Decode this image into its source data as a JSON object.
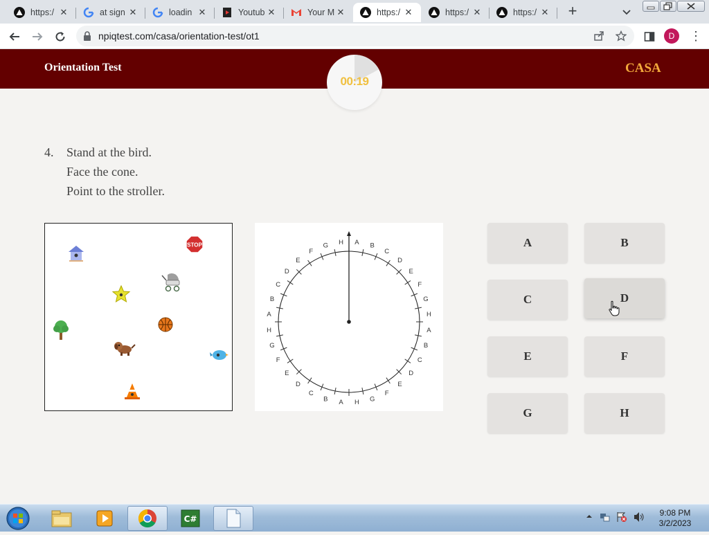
{
  "browser": {
    "tabs": [
      {
        "title": "https:/",
        "favicon": "triangle-site-icon",
        "active": false
      },
      {
        "title": "at sign",
        "favicon": "google-icon",
        "active": false
      },
      {
        "title": "loadin",
        "favicon": "google-icon",
        "active": false
      },
      {
        "title": "Youtub",
        "favicon": "youtube-studio-icon",
        "active": false
      },
      {
        "title": "Your M",
        "favicon": "gmail-icon",
        "active": false
      },
      {
        "title": "https:/",
        "favicon": "triangle-site-icon",
        "active": true
      },
      {
        "title": "https:/",
        "favicon": "triangle-site-icon",
        "active": false
      },
      {
        "title": "https:/",
        "favicon": "triangle-site-icon",
        "active": false
      }
    ],
    "url": "npiqtest.com/casa/orientation-test/ot1",
    "profile_initial": "D",
    "profile_color": "#c2185b"
  },
  "app": {
    "title": "Orientation Test",
    "brand": "CASA",
    "header_color": "#630000",
    "brand_color": "#f3a93b",
    "timer": {
      "text": "00:19",
      "elapsed_fraction": 0.12
    }
  },
  "question": {
    "number": "4.",
    "lines": [
      "Stand at the bird.",
      "Face the cone.",
      "Point to the stroller."
    ]
  },
  "map": {
    "items": [
      {
        "name": "birdhouse"
      },
      {
        "name": "stop-sign",
        "label": "STOP"
      },
      {
        "name": "stroller"
      },
      {
        "name": "star"
      },
      {
        "name": "tree"
      },
      {
        "name": "basketball"
      },
      {
        "name": "dog"
      },
      {
        "name": "bird"
      },
      {
        "name": "cone"
      }
    ]
  },
  "dial": {
    "labels": [
      "A",
      "B",
      "C",
      "D",
      "E",
      "F",
      "G",
      "H",
      "A",
      "B",
      "C",
      "D",
      "E",
      "F",
      "G",
      "H",
      "A",
      "B",
      "C",
      "D",
      "E",
      "F",
      "G",
      "H",
      "A",
      "B",
      "C",
      "D",
      "E",
      "F",
      "G",
      "H"
    ],
    "pointer": "H"
  },
  "answers": [
    "A",
    "B",
    "C",
    "D",
    "E",
    "F",
    "G",
    "H"
  ],
  "taskbar": {
    "apps": [
      "file-explorer",
      "media-player",
      "chrome",
      "csharp-editor",
      "notepad"
    ],
    "time": "9:08 PM",
    "date": "3/2/2023"
  }
}
